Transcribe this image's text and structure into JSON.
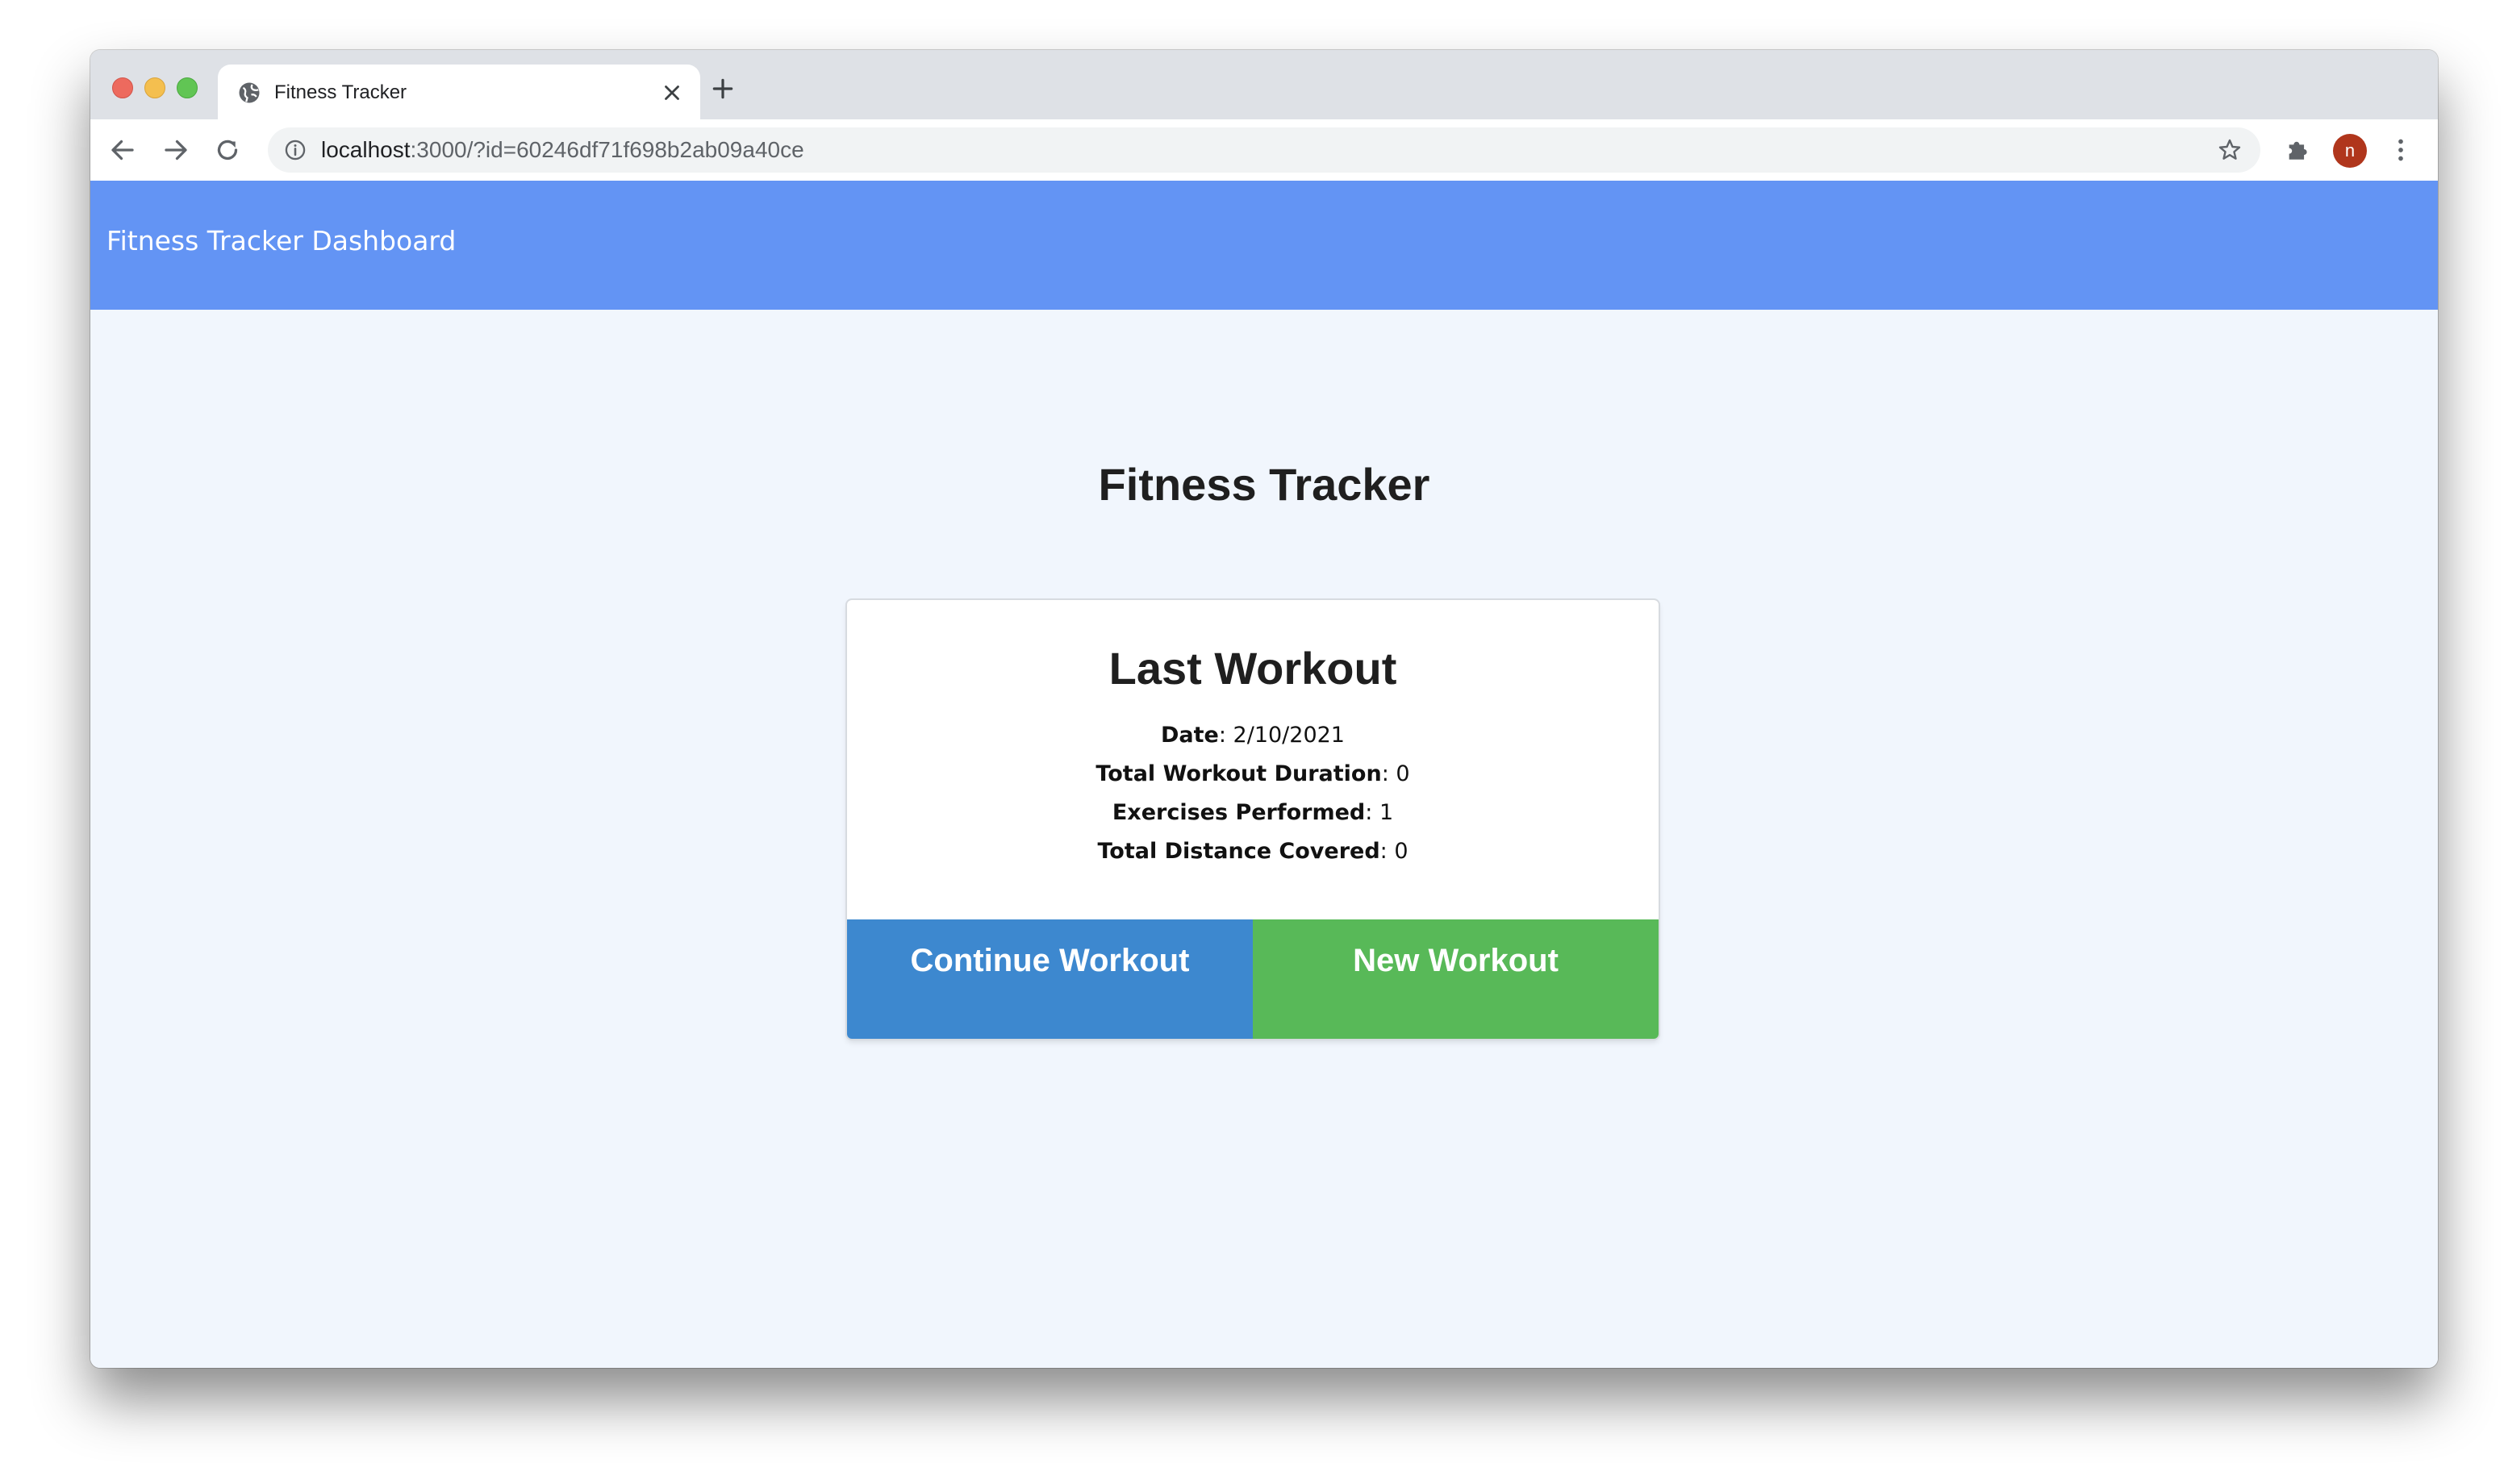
{
  "browser": {
    "tab": {
      "title": "Fitness Tracker",
      "favicon": "globe-icon"
    },
    "address_bar": {
      "host": "localhost",
      "rest": ":3000/?id=60246df71f698b2ab09a40ce"
    },
    "profile_initial": "n"
  },
  "app": {
    "brand": "Fitness Tracker Dashboard",
    "page_title": "Fitness Tracker"
  },
  "card": {
    "title": "Last Workout",
    "stats": [
      {
        "label": "Date",
        "value": "2/10/2021"
      },
      {
        "label": "Total Workout Duration",
        "value": "0"
      },
      {
        "label": "Exercises Performed",
        "value": "1"
      },
      {
        "label": "Total Distance Covered",
        "value": "0"
      }
    ],
    "continue_label": "Continue Workout",
    "new_label": "New Workout"
  },
  "colors": {
    "header": "#6394f4",
    "background": "#f1f6fd",
    "continue_button": "#3d88cf",
    "new_button": "#58b958"
  }
}
